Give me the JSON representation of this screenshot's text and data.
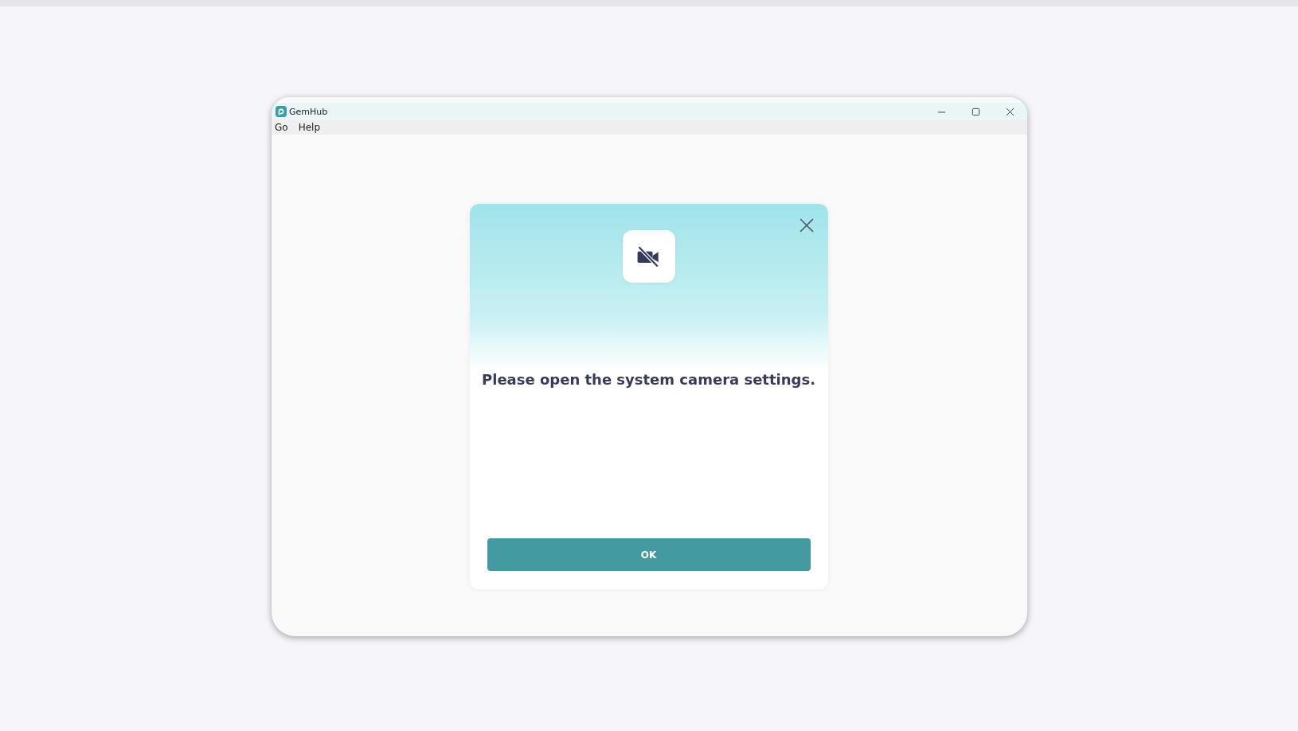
{
  "window": {
    "title": "GemHub"
  },
  "menu": [
    {
      "label": "Go"
    },
    {
      "label": "Help"
    }
  ],
  "dialog": {
    "message": "Please open the system camera settings.",
    "buttons": [
      {
        "label": "OK",
        "kind": "primary"
      }
    ]
  }
}
